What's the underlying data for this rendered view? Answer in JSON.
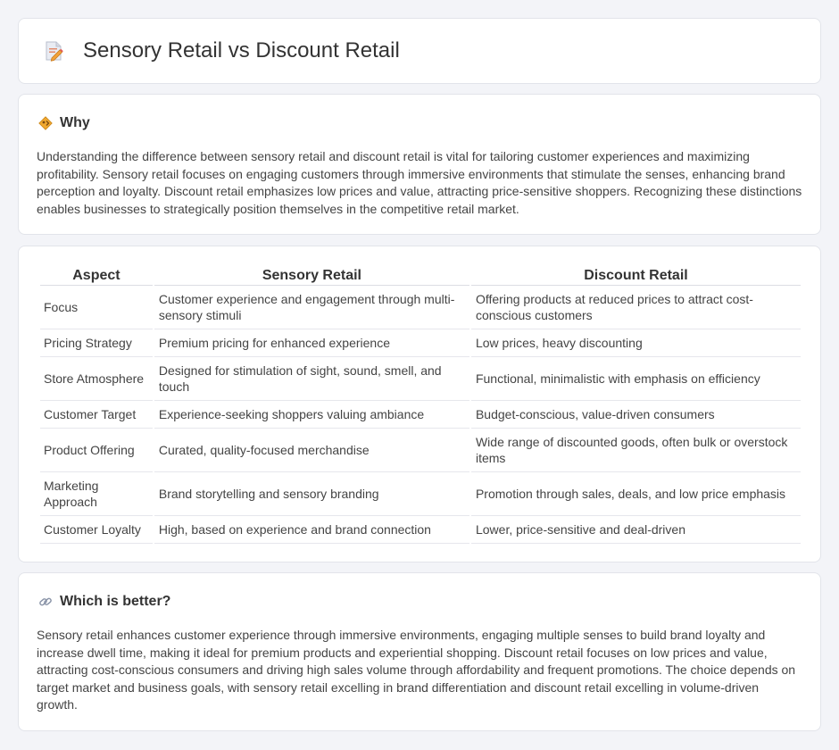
{
  "header": {
    "title": "Sensory Retail vs Discount Retail",
    "icon": "document-pencil-icon"
  },
  "why": {
    "heading": "Why",
    "icon": "diamond-sign-icon",
    "text": "Understanding the difference between sensory retail and discount retail is vital for tailoring customer experiences and maximizing profitability. Sensory retail focuses on engaging customers through immersive environments that stimulate the senses, enhancing brand perception and loyalty. Discount retail emphasizes low prices and value, attracting price-sensitive shoppers. Recognizing these distinctions enables businesses to strategically position themselves in the competitive retail market."
  },
  "table": {
    "headers": [
      "Aspect",
      "Sensory Retail",
      "Discount Retail"
    ],
    "rows": [
      {
        "aspect": "Focus",
        "sensory": "Customer experience and engagement through multi-sensory stimuli",
        "discount": "Offering products at reduced prices to attract cost-conscious customers"
      },
      {
        "aspect": "Pricing Strategy",
        "sensory": "Premium pricing for enhanced experience",
        "discount": "Low prices, heavy discounting"
      },
      {
        "aspect": "Store Atmosphere",
        "sensory": "Designed for stimulation of sight, sound, smell, and touch",
        "discount": "Functional, minimalistic with emphasis on efficiency"
      },
      {
        "aspect": "Customer Target",
        "sensory": "Experience-seeking shoppers valuing ambiance",
        "discount": "Budget-conscious, value-driven consumers"
      },
      {
        "aspect": "Product Offering",
        "sensory": "Curated, quality-focused merchandise",
        "discount": "Wide range of discounted goods, often bulk or overstock items"
      },
      {
        "aspect": "Marketing Approach",
        "sensory": "Brand storytelling and sensory branding",
        "discount": "Promotion through sales, deals, and low price emphasis"
      },
      {
        "aspect": "Customer Loyalty",
        "sensory": "High, based on experience and brand connection",
        "discount": "Lower, price-sensitive and deal-driven"
      }
    ]
  },
  "better": {
    "heading": "Which is better?",
    "icon": "link-icon",
    "text": "Sensory retail enhances customer experience through immersive environments, engaging multiple senses to build brand loyalty and increase dwell time, making it ideal for premium products and experiential shopping. Discount retail focuses on low prices and value, attracting cost-conscious consumers and driving high sales volume through affordability and frequent promotions. The choice depends on target market and business goals, with sensory retail excelling in brand differentiation and discount retail excelling in volume-driven growth."
  }
}
